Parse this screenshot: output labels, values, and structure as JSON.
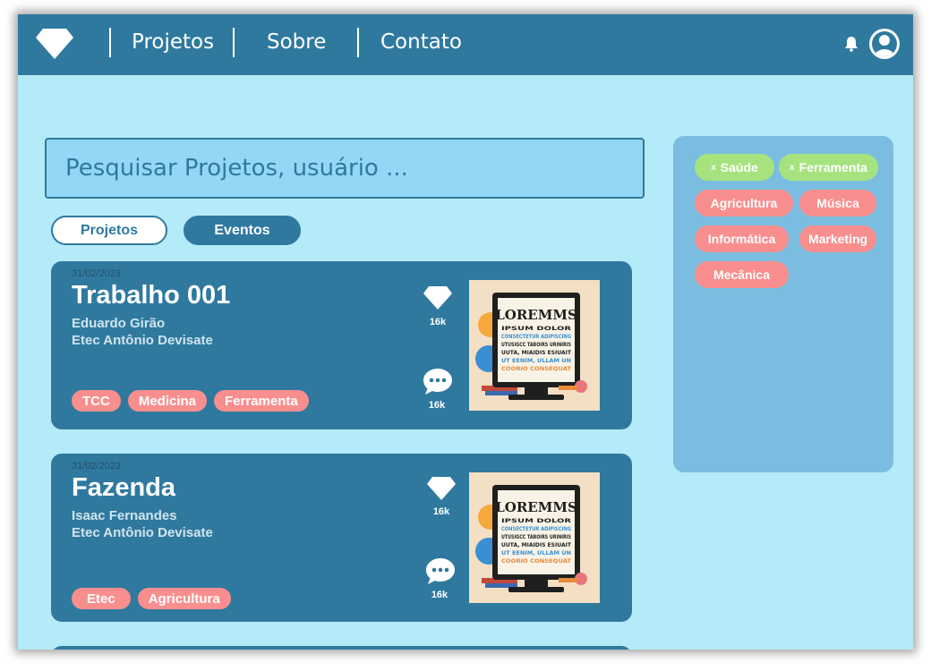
{
  "colors": {
    "header": "#2f799f",
    "page_background": "#b5eaf8",
    "card": "#2f799f",
    "tag": "#f98e8e",
    "selected_chip": "#a6e37f",
    "filter_panel": "#7abde0"
  },
  "nav": {
    "logo_icon": "diamond-icon",
    "links": [
      "Projetos",
      "Sobre",
      "Contato"
    ],
    "notification_icon": "bell-icon",
    "profile_icon": "user-circle-icon"
  },
  "search": {
    "placeholder": "Pesquisar Projetos, usuário ..."
  },
  "tabs": [
    {
      "label": "Projetos",
      "active": true
    },
    {
      "label": "Eventos",
      "active": false
    }
  ],
  "cards": [
    {
      "date": "31/02/2023",
      "title": "Trabalho 001",
      "author": "Eduardo Girão",
      "school": "Etec Antônio Devisate",
      "likes": "16k",
      "comments": "16k",
      "tags": [
        "TCC",
        "Medicina",
        "Ferramenta"
      ]
    },
    {
      "date": "31/02/2023",
      "title": "Fazenda",
      "author": "Isaac Fernandes",
      "school": "Etec Antônio Devisate",
      "likes": "16k",
      "comments": "16k",
      "tags": [
        "Etec",
        "Agricultura"
      ]
    }
  ],
  "filters": {
    "selected": [
      "Saúde",
      "Ferramenta"
    ],
    "options": [
      "Agricultura",
      "Música",
      "Informática",
      "Marketing",
      "Mecânica"
    ],
    "remove_symbol": "x"
  },
  "thumbnail": {
    "heading": "LOREMMS",
    "lines": [
      "IPSUM DOLOR",
      "CONSECTETUR ADIPISCING",
      "UTUSIGCC TABOIRS URINIRIS",
      "UUTA, MIAIDIS ESIUAIT",
      "UT EENIM, ULLAM UN",
      "COORIO CONSEQUAT"
    ]
  }
}
